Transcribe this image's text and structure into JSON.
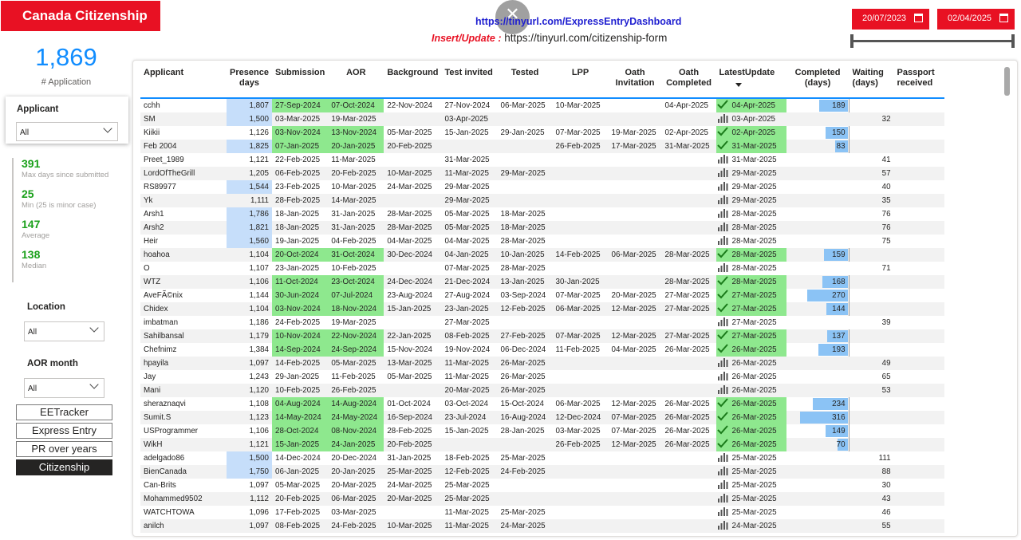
{
  "header": {
    "title": "Canada Citizenship",
    "link_dashboard": "https://tinyurl.com/ExpressEntryDashboard",
    "insert_label": "Insert/Update :",
    "link_form": "https://tinyurl.com/citizenship-form",
    "date_from": "20/07/2023",
    "date_to": "02/04/2025"
  },
  "summary": {
    "count": "1,869",
    "count_label": "# Application"
  },
  "applicant_slicer": {
    "title": "Applicant",
    "value": "All"
  },
  "stats": [
    {
      "value": "391",
      "label": "Max days since submitted"
    },
    {
      "value": "25",
      "label": "Min (25 is minor case)"
    },
    {
      "value": "147",
      "label": "Average"
    },
    {
      "value": "138",
      "label": "Median"
    }
  ],
  "location": {
    "title": "Location",
    "value": "All"
  },
  "aor_month": {
    "title": "AOR month",
    "value": "All"
  },
  "nav": [
    "EETracker",
    "Express Entry",
    "PR over years",
    "Citizenship"
  ],
  "table": {
    "columns": [
      "Applicant",
      "Presence days",
      "Submission",
      "AOR",
      "Background",
      "Test invited",
      "Tested",
      "LPP",
      "Oath Invitation",
      "Oath Completed",
      "LatestUpdate",
      "Completed (days)",
      "Waiting (days)",
      "Passport received"
    ],
    "rows": [
      [
        "cchh",
        "1,807",
        "27-Sep-2024",
        "07-Oct-2024",
        "22-Nov-2024",
        "27-Nov-2024",
        "06-Mar-2025",
        "10-Mar-2025",
        "",
        "04-Apr-2025",
        "04-Apr-2025",
        "189",
        "",
        ""
      ],
      [
        "SM",
        "1,500",
        "03-Mar-2025",
        "19-Mar-2025",
        "",
        "03-Apr-2025",
        "",
        "",
        "",
        "",
        "03-Apr-2025",
        "",
        "32",
        ""
      ],
      [
        "Kiikii",
        "1,126",
        "03-Nov-2024",
        "13-Nov-2024",
        "05-Mar-2025",
        "15-Jan-2025",
        "29-Jan-2025",
        "07-Mar-2025",
        "19-Mar-2025",
        "02-Apr-2025",
        "02-Apr-2025",
        "150",
        "",
        ""
      ],
      [
        "Feb 2004",
        "1,825",
        "07-Jan-2025",
        "20-Jan-2025",
        "20-Feb-2025",
        "",
        "",
        "26-Feb-2025",
        "17-Mar-2025",
        "31-Mar-2025",
        "31-Mar-2025",
        "83",
        "",
        ""
      ],
      [
        "Preet_1989",
        "1,121",
        "22-Feb-2025",
        "11-Mar-2025",
        "",
        "31-Mar-2025",
        "",
        "",
        "",
        "",
        "31-Mar-2025",
        "",
        "41",
        ""
      ],
      [
        "LordOfTheGrill",
        "1,205",
        "06-Feb-2025",
        "20-Feb-2025",
        "10-Mar-2025",
        "11-Mar-2025",
        "29-Mar-2025",
        "",
        "",
        "",
        "29-Mar-2025",
        "",
        "57",
        ""
      ],
      [
        "RS89977",
        "1,544",
        "23-Feb-2025",
        "10-Mar-2025",
        "24-Mar-2025",
        "29-Mar-2025",
        "",
        "",
        "",
        "",
        "29-Mar-2025",
        "",
        "40",
        ""
      ],
      [
        "Yk",
        "1,111",
        "28-Feb-2025",
        "14-Mar-2025",
        "",
        "29-Mar-2025",
        "",
        "",
        "",
        "",
        "29-Mar-2025",
        "",
        "35",
        ""
      ],
      [
        "Arsh1",
        "1,786",
        "18-Jan-2025",
        "31-Jan-2025",
        "28-Mar-2025",
        "05-Mar-2025",
        "18-Mar-2025",
        "",
        "",
        "",
        "28-Mar-2025",
        "",
        "76",
        ""
      ],
      [
        "Arsh2",
        "1,821",
        "18-Jan-2025",
        "31-Jan-2025",
        "28-Mar-2025",
        "05-Mar-2025",
        "18-Mar-2025",
        "",
        "",
        "",
        "28-Mar-2025",
        "",
        "76",
        ""
      ],
      [
        "Heir",
        "1,560",
        "19-Jan-2025",
        "04-Feb-2025",
        "04-Mar-2025",
        "04-Mar-2025",
        "28-Mar-2025",
        "",
        "",
        "",
        "28-Mar-2025",
        "",
        "75",
        ""
      ],
      [
        "hoahoa",
        "1,104",
        "20-Oct-2024",
        "31-Oct-2024",
        "30-Dec-2024",
        "04-Jan-2025",
        "10-Jan-2025",
        "14-Feb-2025",
        "06-Mar-2025",
        "28-Mar-2025",
        "28-Mar-2025",
        "159",
        "",
        ""
      ],
      [
        "O",
        "1,107",
        "23-Jan-2025",
        "10-Feb-2025",
        "",
        "07-Mar-2025",
        "28-Mar-2025",
        "",
        "",
        "",
        "28-Mar-2025",
        "",
        "71",
        ""
      ],
      [
        "WTZ",
        "1,106",
        "11-Oct-2024",
        "23-Oct-2024",
        "24-Dec-2024",
        "21-Dec-2024",
        "13-Jan-2025",
        "30-Jan-2025",
        "",
        "28-Mar-2025",
        "28-Mar-2025",
        "168",
        "",
        ""
      ],
      [
        "AveFÃ©nix",
        "1,144",
        "30-Jun-2024",
        "07-Jul-2024",
        "23-Aug-2024",
        "27-Aug-2024",
        "03-Sep-2024",
        "07-Mar-2025",
        "20-Mar-2025",
        "27-Mar-2025",
        "27-Mar-2025",
        "270",
        "",
        ""
      ],
      [
        "Chidex",
        "1,104",
        "03-Nov-2024",
        "18-Nov-2024",
        "15-Jan-2025",
        "23-Jan-2025",
        "12-Feb-2025",
        "06-Mar-2025",
        "12-Mar-2025",
        "27-Mar-2025",
        "27-Mar-2025",
        "144",
        "",
        ""
      ],
      [
        "imbatman",
        "1,186",
        "24-Feb-2025",
        "19-Mar-2025",
        "",
        "27-Mar-2025",
        "",
        "",
        "",
        "",
        "27-Mar-2025",
        "",
        "39",
        ""
      ],
      [
        "Sahilbansal",
        "1,179",
        "10-Nov-2024",
        "22-Nov-2024",
        "22-Jan-2025",
        "08-Feb-2025",
        "27-Feb-2025",
        "07-Mar-2025",
        "12-Mar-2025",
        "27-Mar-2025",
        "27-Mar-2025",
        "137",
        "",
        ""
      ],
      [
        "Chefnimz",
        "1,384",
        "14-Sep-2024",
        "24-Sep-2024",
        "15-Nov-2024",
        "19-Nov-2024",
        "06-Dec-2024",
        "11-Feb-2025",
        "04-Mar-2025",
        "26-Mar-2025",
        "26-Mar-2025",
        "193",
        "",
        ""
      ],
      [
        "hpayila",
        "1,097",
        "14-Feb-2025",
        "05-Mar-2025",
        "13-Mar-2025",
        "11-Mar-2025",
        "26-Mar-2025",
        "",
        "",
        "",
        "26-Mar-2025",
        "",
        "49",
        ""
      ],
      [
        "Jay",
        "1,243",
        "29-Jan-2025",
        "11-Feb-2025",
        "05-Mar-2025",
        "11-Mar-2025",
        "26-Mar-2025",
        "",
        "",
        "",
        "26-Mar-2025",
        "",
        "65",
        ""
      ],
      [
        "Mani",
        "1,120",
        "10-Feb-2025",
        "26-Feb-2025",
        "",
        "20-Mar-2025",
        "26-Mar-2025",
        "",
        "",
        "",
        "26-Mar-2025",
        "",
        "53",
        ""
      ],
      [
        "sheraznaqvi",
        "1,108",
        "04-Aug-2024",
        "14-Aug-2024",
        "01-Oct-2024",
        "03-Oct-2024",
        "15-Oct-2024",
        "06-Mar-2025",
        "12-Mar-2025",
        "26-Mar-2025",
        "26-Mar-2025",
        "234",
        "",
        ""
      ],
      [
        "Sumit.S",
        "1,123",
        "14-May-2024",
        "24-May-2024",
        "16-Sep-2024",
        "23-Jul-2024",
        "16-Aug-2024",
        "12-Dec-2024",
        "07-Mar-2025",
        "26-Mar-2025",
        "26-Mar-2025",
        "316",
        "",
        ""
      ],
      [
        "USProgrammer",
        "1,106",
        "28-Oct-2024",
        "08-Nov-2024",
        "28-Feb-2025",
        "15-Jan-2025",
        "28-Jan-2025",
        "03-Mar-2025",
        "07-Mar-2025",
        "26-Mar-2025",
        "26-Mar-2025",
        "149",
        "",
        ""
      ],
      [
        "WikH",
        "1,121",
        "15-Jan-2025",
        "24-Jan-2025",
        "20-Feb-2025",
        "",
        "",
        "26-Feb-2025",
        "12-Mar-2025",
        "26-Mar-2025",
        "26-Mar-2025",
        "70",
        "",
        ""
      ],
      [
        "adelgado86",
        "1,500",
        "14-Dec-2024",
        "20-Dec-2024",
        "31-Jan-2025",
        "18-Feb-2025",
        "25-Mar-2025",
        "",
        "",
        "",
        "25-Mar-2025",
        "",
        "111",
        ""
      ],
      [
        "BienCanada",
        "1,750",
        "06-Jan-2025",
        "20-Jan-2025",
        "25-Mar-2025",
        "12-Feb-2025",
        "24-Feb-2025",
        "",
        "",
        "",
        "25-Mar-2025",
        "",
        "88",
        ""
      ],
      [
        "Can-Brits",
        "1,097",
        "05-Mar-2025",
        "20-Mar-2025",
        "24-Mar-2025",
        "25-Mar-2025",
        "",
        "",
        "",
        "",
        "25-Mar-2025",
        "",
        "30",
        ""
      ],
      [
        "Mohammed9502",
        "1,112",
        "20-Feb-2025",
        "06-Mar-2025",
        "20-Mar-2025",
        "25-Mar-2025",
        "",
        "",
        "",
        "",
        "25-Mar-2025",
        "",
        "43",
        ""
      ],
      [
        "WATCHTOWA",
        "1,096",
        "17-Feb-2025",
        "03-Mar-2025",
        "",
        "11-Mar-2025",
        "25-Mar-2025",
        "",
        "",
        "",
        "25-Mar-2025",
        "",
        "46",
        ""
      ],
      [
        "anilch",
        "1,097",
        "08-Feb-2025",
        "24-Feb-2025",
        "10-Mar-2025",
        "11-Mar-2025",
        "24-Mar-2025",
        "",
        "",
        "",
        "24-Mar-2025",
        "",
        "55",
        ""
      ]
    ],
    "presence_highlight": [
      true,
      true,
      false,
      true,
      false,
      false,
      true,
      false,
      true,
      true,
      true,
      false,
      false,
      false,
      false,
      false,
      false,
      false,
      false,
      false,
      false,
      false,
      false,
      false,
      false,
      false,
      true,
      true,
      false,
      false,
      false,
      false
    ],
    "max_completed": 316
  },
  "colors": {
    "brand": "#e81123",
    "accent": "#118dff",
    "green": "#8ee88e",
    "presence": "#c6defa",
    "bar": "#8bc3f5"
  }
}
